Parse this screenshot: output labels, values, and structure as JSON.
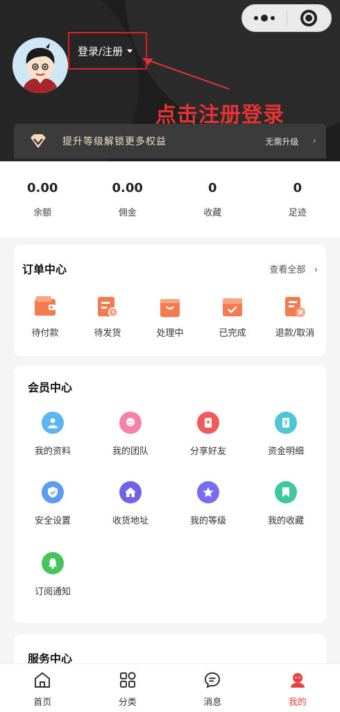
{
  "annotation": {
    "text": "点击注册登录",
    "color": "#e53333"
  },
  "capsule": {
    "more_icon": "more-dots-icon",
    "close_icon": "target-icon"
  },
  "profile": {
    "avatar_icon": "cartoon-boy-avatar",
    "login_label": "登录/注册"
  },
  "vip": {
    "text": "提升等级解锁更多权益",
    "action": "无需升级",
    "icon": "diamond-icon"
  },
  "stats": [
    {
      "value": "0.00",
      "label": "余额"
    },
    {
      "value": "0.00",
      "label": "佣金"
    },
    {
      "value": "0",
      "label": "收藏"
    },
    {
      "value": "0",
      "label": "足迹"
    }
  ],
  "orders": {
    "title": "订单中心",
    "more": "查看全部",
    "items": [
      {
        "label": "待付款",
        "icon": "wallet-icon"
      },
      {
        "label": "待发货",
        "icon": "pending-shipment-icon"
      },
      {
        "label": "处理中",
        "icon": "basket-icon"
      },
      {
        "label": "已完成",
        "icon": "box-check-icon"
      },
      {
        "label": "退款/取消",
        "icon": "refund-cancel-icon"
      }
    ],
    "accent": "#f47b4f"
  },
  "member": {
    "title": "会员中心",
    "items": [
      {
        "label": "我的资料",
        "icon": "profile-icon",
        "color": "#5bb5f0"
      },
      {
        "label": "我的团队",
        "icon": "team-icon",
        "color": "#f582a8"
      },
      {
        "label": "分享好友",
        "icon": "share-icon",
        "color": "#f05a5a"
      },
      {
        "label": "资金明细",
        "icon": "funds-icon",
        "color": "#4fc6d8"
      },
      {
        "label": "安全设置",
        "icon": "shield-icon",
        "color": "#5b9bf2"
      },
      {
        "label": "收货地址",
        "icon": "home-icon",
        "color": "#6e62e8"
      },
      {
        "label": "我的等级",
        "icon": "star-icon",
        "color": "#7a6cf0"
      },
      {
        "label": "我的收藏",
        "icon": "bookmark-icon",
        "color": "#40c9a0"
      },
      {
        "label": "订阅通知",
        "icon": "bell-icon",
        "color": "#46c45a"
      }
    ]
  },
  "service": {
    "title": "服务中心"
  },
  "tabbar": {
    "items": [
      {
        "label": "首页",
        "icon": "home-outline-icon"
      },
      {
        "label": "分类",
        "icon": "category-icon"
      },
      {
        "label": "消息",
        "icon": "message-icon"
      },
      {
        "label": "我的",
        "icon": "user-icon"
      }
    ],
    "active_index": 3,
    "active_color": "#e64340"
  }
}
